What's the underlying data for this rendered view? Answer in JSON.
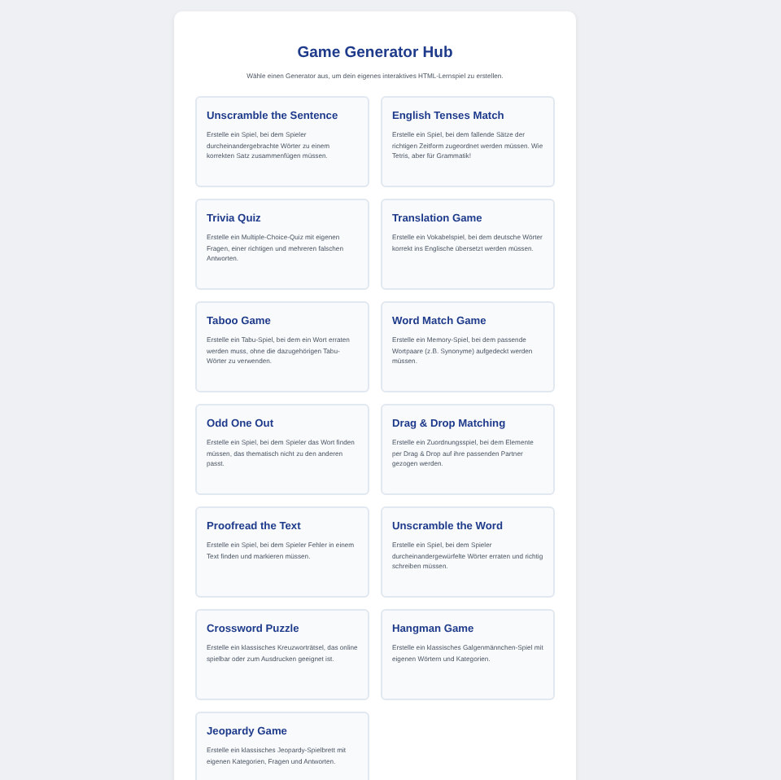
{
  "title": "Game Generator Hub",
  "subtitle": "Wähle einen Generator aus, um dein eigenes interaktives HTML-Lernspiel zu erstellen.",
  "generators": [
    {
      "title": "Unscramble the Sentence",
      "description": "Erstelle ein Spiel, bei dem Spieler durcheinandergebrachte Wörter zu einem korrekten Satz zusammenfügen müssen."
    },
    {
      "title": "English Tenses Match",
      "description": "Erstelle ein Spiel, bei dem fallende Sätze der richtigen Zeitform zugeordnet werden müssen. Wie Tetris, aber für Grammatik!"
    },
    {
      "title": "Trivia Quiz",
      "description": "Erstelle ein Multiple-Choice-Quiz mit eigenen Fragen, einer richtigen und mehreren falschen Antworten."
    },
    {
      "title": "Translation Game",
      "description": "Erstelle ein Vokabelspiel, bei dem deutsche Wörter korrekt ins Englische übersetzt werden müssen."
    },
    {
      "title": "Taboo Game",
      "description": "Erstelle ein Tabu-Spiel, bei dem ein Wort erraten werden muss, ohne die dazugehörigen Tabu-Wörter zu verwenden."
    },
    {
      "title": "Word Match Game",
      "description": "Erstelle ein Memory-Spiel, bei dem passende Wortpaare (z.B. Synonyme) aufgedeckt werden müssen."
    },
    {
      "title": "Odd One Out",
      "description": "Erstelle ein Spiel, bei dem Spieler das Wort finden müssen, das thematisch nicht zu den anderen passt."
    },
    {
      "title": "Drag & Drop Matching",
      "description": "Erstelle ein Zuordnungsspiel, bei dem Elemente per Drag & Drop auf ihre passenden Partner gezogen werden."
    },
    {
      "title": "Proofread the Text",
      "description": "Erstelle ein Spiel, bei dem Spieler Fehler in einem Text finden und markieren müssen."
    },
    {
      "title": "Unscramble the Word",
      "description": "Erstelle ein Spiel, bei dem Spieler durcheinandergewürfelte Wörter erraten und richtig schreiben müssen."
    },
    {
      "title": "Crossword Puzzle",
      "description": "Erstelle ein klassisches Kreuzworträtsel, das online spielbar oder zum Ausdrucken geeignet ist."
    },
    {
      "title": "Hangman Game",
      "description": "Erstelle ein klassisches Galgenmännchen-Spiel mit eigenen Wörtern und Kategorien."
    },
    {
      "title": "Jeopardy Game",
      "description": "Erstelle ein klassisches Jeopardy-Spielbrett mit eigenen Kategorien, Fragen und Antworten."
    }
  ]
}
